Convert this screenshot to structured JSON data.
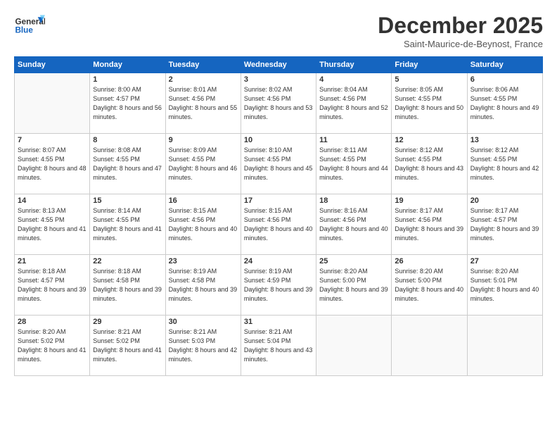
{
  "header": {
    "logo_general": "General",
    "logo_blue": "Blue",
    "month_title": "December 2025",
    "subtitle": "Saint-Maurice-de-Beynost, France"
  },
  "weekdays": [
    "Sunday",
    "Monday",
    "Tuesday",
    "Wednesday",
    "Thursday",
    "Friday",
    "Saturday"
  ],
  "weeks": [
    [
      {
        "day": "",
        "sunrise": "",
        "sunset": "",
        "daylight": ""
      },
      {
        "day": "1",
        "sunrise": "Sunrise: 8:00 AM",
        "sunset": "Sunset: 4:57 PM",
        "daylight": "Daylight: 8 hours and 56 minutes."
      },
      {
        "day": "2",
        "sunrise": "Sunrise: 8:01 AM",
        "sunset": "Sunset: 4:56 PM",
        "daylight": "Daylight: 8 hours and 55 minutes."
      },
      {
        "day": "3",
        "sunrise": "Sunrise: 8:02 AM",
        "sunset": "Sunset: 4:56 PM",
        "daylight": "Daylight: 8 hours and 53 minutes."
      },
      {
        "day": "4",
        "sunrise": "Sunrise: 8:04 AM",
        "sunset": "Sunset: 4:56 PM",
        "daylight": "Daylight: 8 hours and 52 minutes."
      },
      {
        "day": "5",
        "sunrise": "Sunrise: 8:05 AM",
        "sunset": "Sunset: 4:55 PM",
        "daylight": "Daylight: 8 hours and 50 minutes."
      },
      {
        "day": "6",
        "sunrise": "Sunrise: 8:06 AM",
        "sunset": "Sunset: 4:55 PM",
        "daylight": "Daylight: 8 hours and 49 minutes."
      }
    ],
    [
      {
        "day": "7",
        "sunrise": "Sunrise: 8:07 AM",
        "sunset": "Sunset: 4:55 PM",
        "daylight": "Daylight: 8 hours and 48 minutes."
      },
      {
        "day": "8",
        "sunrise": "Sunrise: 8:08 AM",
        "sunset": "Sunset: 4:55 PM",
        "daylight": "Daylight: 8 hours and 47 minutes."
      },
      {
        "day": "9",
        "sunrise": "Sunrise: 8:09 AM",
        "sunset": "Sunset: 4:55 PM",
        "daylight": "Daylight: 8 hours and 46 minutes."
      },
      {
        "day": "10",
        "sunrise": "Sunrise: 8:10 AM",
        "sunset": "Sunset: 4:55 PM",
        "daylight": "Daylight: 8 hours and 45 minutes."
      },
      {
        "day": "11",
        "sunrise": "Sunrise: 8:11 AM",
        "sunset": "Sunset: 4:55 PM",
        "daylight": "Daylight: 8 hours and 44 minutes."
      },
      {
        "day": "12",
        "sunrise": "Sunrise: 8:12 AM",
        "sunset": "Sunset: 4:55 PM",
        "daylight": "Daylight: 8 hours and 43 minutes."
      },
      {
        "day": "13",
        "sunrise": "Sunrise: 8:12 AM",
        "sunset": "Sunset: 4:55 PM",
        "daylight": "Daylight: 8 hours and 42 minutes."
      }
    ],
    [
      {
        "day": "14",
        "sunrise": "Sunrise: 8:13 AM",
        "sunset": "Sunset: 4:55 PM",
        "daylight": "Daylight: 8 hours and 41 minutes."
      },
      {
        "day": "15",
        "sunrise": "Sunrise: 8:14 AM",
        "sunset": "Sunset: 4:55 PM",
        "daylight": "Daylight: 8 hours and 41 minutes."
      },
      {
        "day": "16",
        "sunrise": "Sunrise: 8:15 AM",
        "sunset": "Sunset: 4:56 PM",
        "daylight": "Daylight: 8 hours and 40 minutes."
      },
      {
        "day": "17",
        "sunrise": "Sunrise: 8:15 AM",
        "sunset": "Sunset: 4:56 PM",
        "daylight": "Daylight: 8 hours and 40 minutes."
      },
      {
        "day": "18",
        "sunrise": "Sunrise: 8:16 AM",
        "sunset": "Sunset: 4:56 PM",
        "daylight": "Daylight: 8 hours and 40 minutes."
      },
      {
        "day": "19",
        "sunrise": "Sunrise: 8:17 AM",
        "sunset": "Sunset: 4:56 PM",
        "daylight": "Daylight: 8 hours and 39 minutes."
      },
      {
        "day": "20",
        "sunrise": "Sunrise: 8:17 AM",
        "sunset": "Sunset: 4:57 PM",
        "daylight": "Daylight: 8 hours and 39 minutes."
      }
    ],
    [
      {
        "day": "21",
        "sunrise": "Sunrise: 8:18 AM",
        "sunset": "Sunset: 4:57 PM",
        "daylight": "Daylight: 8 hours and 39 minutes."
      },
      {
        "day": "22",
        "sunrise": "Sunrise: 8:18 AM",
        "sunset": "Sunset: 4:58 PM",
        "daylight": "Daylight: 8 hours and 39 minutes."
      },
      {
        "day": "23",
        "sunrise": "Sunrise: 8:19 AM",
        "sunset": "Sunset: 4:58 PM",
        "daylight": "Daylight: 8 hours and 39 minutes."
      },
      {
        "day": "24",
        "sunrise": "Sunrise: 8:19 AM",
        "sunset": "Sunset: 4:59 PM",
        "daylight": "Daylight: 8 hours and 39 minutes."
      },
      {
        "day": "25",
        "sunrise": "Sunrise: 8:20 AM",
        "sunset": "Sunset: 5:00 PM",
        "daylight": "Daylight: 8 hours and 39 minutes."
      },
      {
        "day": "26",
        "sunrise": "Sunrise: 8:20 AM",
        "sunset": "Sunset: 5:00 PM",
        "daylight": "Daylight: 8 hours and 40 minutes."
      },
      {
        "day": "27",
        "sunrise": "Sunrise: 8:20 AM",
        "sunset": "Sunset: 5:01 PM",
        "daylight": "Daylight: 8 hours and 40 minutes."
      }
    ],
    [
      {
        "day": "28",
        "sunrise": "Sunrise: 8:20 AM",
        "sunset": "Sunset: 5:02 PM",
        "daylight": "Daylight: 8 hours and 41 minutes."
      },
      {
        "day": "29",
        "sunrise": "Sunrise: 8:21 AM",
        "sunset": "Sunset: 5:02 PM",
        "daylight": "Daylight: 8 hours and 41 minutes."
      },
      {
        "day": "30",
        "sunrise": "Sunrise: 8:21 AM",
        "sunset": "Sunset: 5:03 PM",
        "daylight": "Daylight: 8 hours and 42 minutes."
      },
      {
        "day": "31",
        "sunrise": "Sunrise: 8:21 AM",
        "sunset": "Sunset: 5:04 PM",
        "daylight": "Daylight: 8 hours and 43 minutes."
      },
      {
        "day": "",
        "sunrise": "",
        "sunset": "",
        "daylight": ""
      },
      {
        "day": "",
        "sunrise": "",
        "sunset": "",
        "daylight": ""
      },
      {
        "day": "",
        "sunrise": "",
        "sunset": "",
        "daylight": ""
      }
    ]
  ]
}
